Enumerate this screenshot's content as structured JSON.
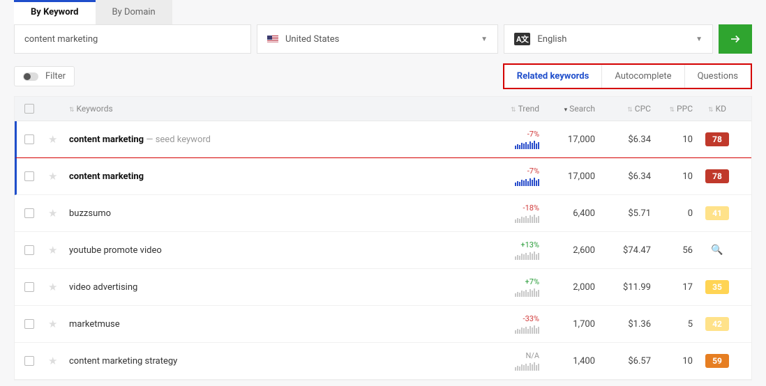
{
  "tabs": {
    "by_keyword": "By Keyword",
    "by_domain": "By Domain"
  },
  "search": {
    "keyword_value": "content marketing",
    "country_label": "United States",
    "language_label": "English"
  },
  "filter": {
    "label": "Filter"
  },
  "type_tabs": {
    "related": "Related keywords",
    "autocomplete": "Autocomplete",
    "questions": "Questions"
  },
  "columns": {
    "keywords": "Keywords",
    "trend": "Trend",
    "search": "Search",
    "cpc": "CPC",
    "ppc": "PPC",
    "kd": "KD"
  },
  "rows": [
    {
      "kw": "content marketing",
      "seed_note": " — seed keyword",
      "trend": "-7%",
      "trend_class": "neg",
      "spark": "blue",
      "search": "17,000",
      "cpc": "$6.34",
      "ppc": "10",
      "kd": "78",
      "kd_class": "kd-red",
      "hl": true,
      "seed": true
    },
    {
      "kw": "content marketing",
      "seed_note": "",
      "trend": "-7%",
      "trend_class": "neg",
      "spark": "blue",
      "search": "17,000",
      "cpc": "$6.34",
      "ppc": "10",
      "kd": "78",
      "kd_class": "kd-red",
      "hl": true,
      "seed": false
    },
    {
      "kw": "buzzsumo",
      "seed_note": "",
      "trend": "-18%",
      "trend_class": "neg",
      "spark": "grey",
      "search": "6,400",
      "cpc": "$5.71",
      "ppc": "0",
      "kd": "41",
      "kd_class": "kd-ylight",
      "hl": false,
      "seed": false
    },
    {
      "kw": "youtube promote video",
      "seed_note": "",
      "trend": "+13%",
      "trend_class": "pos",
      "spark": "grey",
      "search": "2,600",
      "cpc": "$74.47",
      "ppc": "56",
      "kd": "search-icon",
      "kd_class": "kd-search",
      "hl": false,
      "seed": false
    },
    {
      "kw": "video advertising",
      "seed_note": "",
      "trend": "+7%",
      "trend_class": "pos",
      "spark": "grey",
      "search": "2,000",
      "cpc": "$11.99",
      "ppc": "17",
      "kd": "35",
      "kd_class": "kd-yellow",
      "hl": false,
      "seed": false
    },
    {
      "kw": "marketmuse",
      "seed_note": "",
      "trend": "-33%",
      "trend_class": "neg",
      "spark": "grey",
      "search": "1,700",
      "cpc": "$1.36",
      "ppc": "5",
      "kd": "42",
      "kd_class": "kd-ylight",
      "hl": false,
      "seed": false
    },
    {
      "kw": "content marketing strategy",
      "seed_note": "",
      "trend": "N/A",
      "trend_class": "na",
      "spark": "grey",
      "search": "1,400",
      "cpc": "$6.57",
      "ppc": "10",
      "kd": "59",
      "kd_class": "kd-orange",
      "hl": false,
      "seed": false
    }
  ]
}
